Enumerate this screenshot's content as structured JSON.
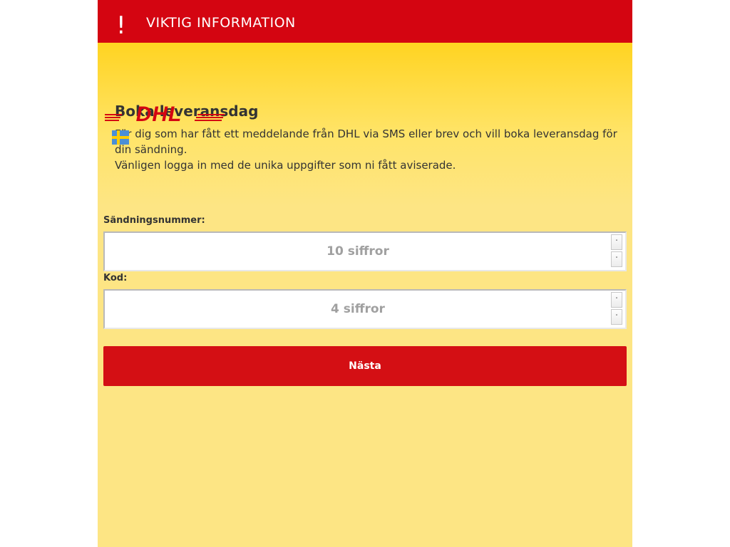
{
  "banner": {
    "icon": "!",
    "title": "VIKTIG INFORMATION"
  },
  "logo": {
    "text": "DHL",
    "brand_color": "#d40511"
  },
  "flag": {
    "icon": "sweden-flag-icon",
    "colors": [
      "#4a8fd6",
      "#ffcc00"
    ]
  },
  "main": {
    "heading": "Boka leveransdag",
    "intro_line1": "För dig som har fått ett meddelande från DHL via SMS eller brev och vill boka leveransdag för din sändning.",
    "intro_line2": "Vänligen logga in med de unika uppgifter som ni fått aviserade."
  },
  "form": {
    "shipment_label": "Sändningsnummer:",
    "shipment_placeholder": "10 siffror",
    "shipment_value": "",
    "code_label": "Kod:",
    "code_placeholder": "4 siffror",
    "code_value": "",
    "spin_up": "˄",
    "spin_down": "˅",
    "next_label": "Nästa"
  },
  "colors": {
    "banner": "#d40511",
    "button": "#d40f14",
    "background_top": "#ffcc00",
    "background_bottom": "#fde584"
  }
}
